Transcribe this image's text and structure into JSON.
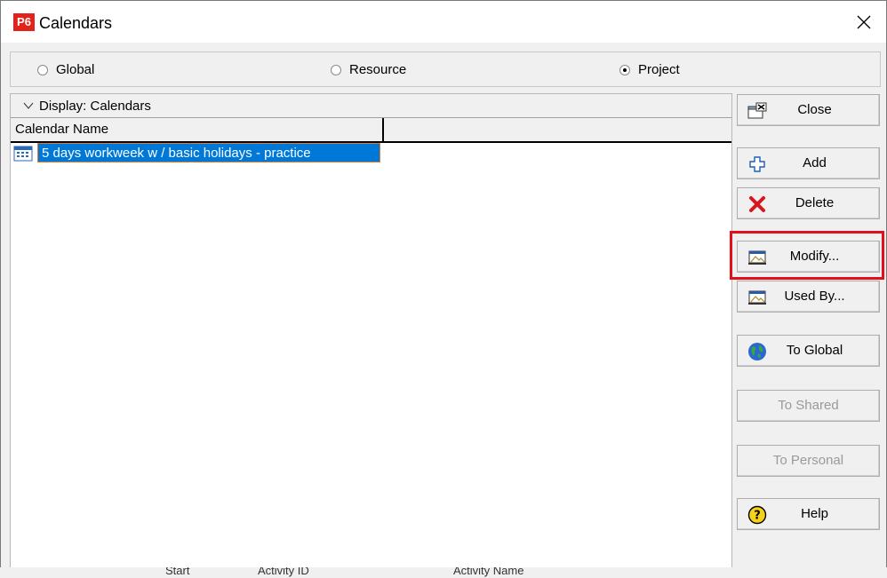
{
  "window": {
    "logo_text": "P6",
    "title": "Calendars"
  },
  "scope": {
    "options": [
      {
        "label": "Global",
        "checked": false
      },
      {
        "label": "Resource",
        "checked": false
      },
      {
        "label": "Project",
        "checked": true
      }
    ]
  },
  "list": {
    "display_label": "Display: Calendars",
    "column_header": "Calendar Name",
    "rows": [
      {
        "name": "5 days workweek w / basic holidays - practice",
        "selected": true
      }
    ]
  },
  "buttons": {
    "close": "Close",
    "add": "Add",
    "delete": "Delete",
    "modify": "Modify...",
    "used_by": "Used By...",
    "to_global": "To Global",
    "to_shared": "To Shared",
    "to_personal": "To Personal",
    "help": "Help"
  },
  "background": {
    "col_a": "Start",
    "col_b": "Activity ID",
    "col_c": "Activity Name"
  },
  "colors": {
    "selection": "#0078d7",
    "selection_border": "#e07b2b",
    "highlight_box": "#e3101b",
    "logo": "#e2231a"
  },
  "icons": {
    "close": "close-window-icon",
    "add": "plus-icon",
    "delete": "red-x-icon",
    "modify": "modify-icon",
    "used_by": "used-by-icon",
    "to_global": "globe-icon",
    "help": "help-icon"
  }
}
